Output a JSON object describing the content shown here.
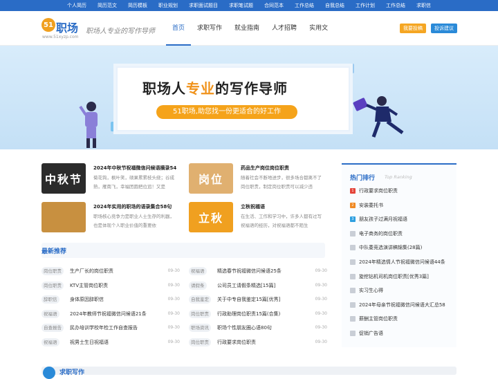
{
  "topbar": {
    "links": [
      "个人简历",
      "简历范文",
      "简历模板",
      "职业规划",
      "求职面试题目",
      "求职笔试题",
      "合同范本",
      "工作总结",
      "自我总结",
      "工作计划",
      "工作总结",
      "求职信"
    ]
  },
  "header": {
    "logo_badge": "51",
    "logo_text": "职场",
    "logo_url": "www.51xyzp.com",
    "slogan": "职场人专业的写作导师",
    "nav": [
      "首页",
      "求职写作",
      "就业指南",
      "人才招聘",
      "实用文"
    ],
    "contribute_label": "我要投稿",
    "complain_label": "投诉建议"
  },
  "banner": {
    "headline_a": "职场人",
    "headline_b": "专业",
    "headline_c": "的写作导师",
    "pill": "51职场,助您找一份更适合的好工作"
  },
  "featured": [
    {
      "thumb": "中秋节",
      "title": "2024年中秋节祝福微信问候语摘录54",
      "desc": "菊花钩，枫叶笑，硕果累累枝头绕；谷成熟，雁南飞，幸福团圆把位追！又是",
      "color": "#2b2b2b"
    },
    {
      "thumb": "岗位",
      "title": "药品生产岗位岗位职责",
      "desc": "随着社会不断地进步，很多场合都离不了岗位职责，制定岗位职责可以减少违",
      "color": "#e0b070"
    },
    {
      "thumb": "",
      "title": "2024年实用的职场的语录集合58句",
      "desc": "职场核心竞争力是职业人士生存的利器，也是体现个人职业价值的重要依",
      "color": "#c89040"
    },
    {
      "thumb": "立秋",
      "title": "立秋祝福语",
      "desc": "在生活、工作和学习中，许多人都有过写祝福语的经历，对祝福语都不陌生",
      "color": "#f0a020"
    }
  ],
  "latest": {
    "heading": "最新推荐",
    "left": [
      {
        "tag": "岗位职责",
        "text": "生产厂长的岗位职责",
        "date": "09-30"
      },
      {
        "tag": "岗位职责",
        "text": "KTV主管岗位职责",
        "date": "09-30"
      },
      {
        "tag": "辞职信",
        "text": "身体原因辞职信",
        "date": "09-30"
      },
      {
        "tag": "祝福语",
        "text": "2024年教师节祝福微信问候语21条",
        "date": "09-30"
      },
      {
        "tag": "自查报告",
        "text": "民办培训学校年检工作自查报告",
        "date": "09-30"
      },
      {
        "tag": "祝福语",
        "text": "祝男士生日祝福语",
        "date": "09-30"
      }
    ],
    "right": [
      {
        "tag": "祝福语",
        "text": "精选春节祝福微信问候语25条",
        "date": "09-30"
      },
      {
        "tag": "请假条",
        "text": "公司员工请假条精选[15篇]",
        "date": "09-30"
      },
      {
        "tag": "自我鉴定",
        "text": "关于中专自我鉴定15篇[优秀]",
        "date": "09-30"
      },
      {
        "tag": "岗位职责",
        "text": "行政助理岗位职责15篇(合集)",
        "date": "09-30"
      },
      {
        "tag": "职场资讯",
        "text": "职场个性朋友圈心语80句",
        "date": "09-30"
      },
      {
        "tag": "岗位职责",
        "text": "行政要求岗位职责",
        "date": "09-30"
      }
    ]
  },
  "hot": {
    "title": "热门排行",
    "subtitle": "Top Ranking",
    "items": [
      "行政要求岗位职责",
      "安装委托书",
      "朋友孩子过满月祝福语",
      "电子商务的岗位职责",
      "中队委竞选演讲稿锦集(28篇)",
      "2024年精选情人节祝福微信问候语44条",
      "旋挖钻机司机岗位职责[优秀3篇]",
      "实习生心得",
      "2024年母亲节祝福微信问候语大汇总58",
      "薪酬主管岗位职责",
      "促销广告语"
    ],
    "num_colors": [
      "#e4453a",
      "#f08a24",
      "#2fa0e0",
      "#c9ced6"
    ]
  },
  "footer": {
    "title": "求职写作"
  }
}
